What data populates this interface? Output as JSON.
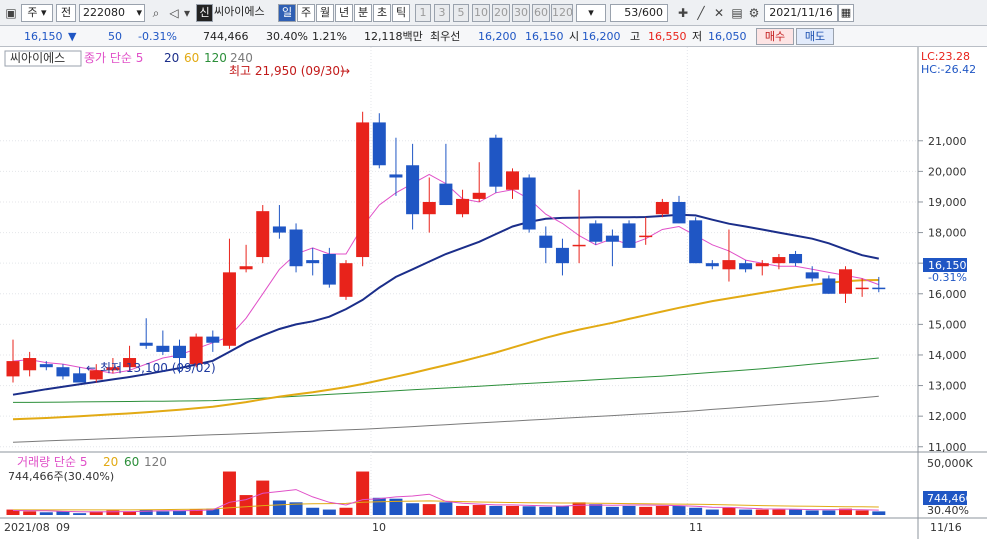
{
  "toolbar": {
    "period_select": "주",
    "prev_label": "전",
    "code": "222080",
    "name": "씨아이에스",
    "new_badge": "신",
    "tabs": [
      "일",
      "주",
      "월",
      "년",
      "분",
      "초",
      "틱"
    ],
    "active_tab": "일",
    "numbers": [
      "1",
      "3",
      "5",
      "10",
      "20",
      "30",
      "60",
      "120"
    ],
    "count": "53/600",
    "date": "2021/11/16"
  },
  "quote": {
    "price": "16,150",
    "change": "50",
    "change_pct": "-0.31%",
    "volume": "744,466",
    "turnover_pct": "30.40%",
    "pct2": "1.21%",
    "amount": "12,118백만",
    "best_bid_label": "최우선",
    "best_ask": "16,200",
    "best_bid": "16,150",
    "open_label": "시",
    "open": "16,200",
    "high_label": "고",
    "high": "16,550",
    "low_label": "저",
    "low": "16,050",
    "buy_label": "매수",
    "sell_label": "매도"
  },
  "legend": {
    "name": "씨아이에스",
    "ma_label": "종가 단순 5",
    "ma_periods": [
      "20",
      "60",
      "120",
      "240"
    ],
    "lc": "LC:23.28",
    "hc": "HC:-26.42"
  },
  "annotations": {
    "high": "최고 21,950 (09/30)",
    "low": "최저 13,100 (09/02)"
  },
  "price_box": {
    "value": "16,150",
    "pct": "-0.31%"
  },
  "volume_legend": {
    "label": "거래량 단순 5",
    "periods": [
      "20",
      "60",
      "120"
    ],
    "value_text": "744,466주(30.40%)",
    "axis_top": "50,000K",
    "current": "744,466",
    "current_pct": "30.40%"
  },
  "x_axis": {
    "labels": [
      "2021/08",
      "09",
      "10",
      "11"
    ],
    "end_label": "11/16"
  },
  "colors": {
    "up": "#e8231b",
    "down": "#1f56c4",
    "ma5": "#e050c8",
    "ma20": "#1b2e8a",
    "ma60": "#e2aa14",
    "ma120": "#2c8f3a",
    "ma240": "#7a7a7a",
    "accent": "#2f5fb3"
  },
  "chart_data": {
    "type": "candlestick",
    "y_ticks": [
      11000,
      12000,
      13000,
      14000,
      15000,
      16000,
      17000,
      18000,
      19000,
      20000,
      21000
    ],
    "ylim": [
      10600,
      22300
    ],
    "candles": [
      {
        "o": 13300,
        "h": 14500,
        "l": 13100,
        "c": 13800
      },
      {
        "o": 13500,
        "h": 14100,
        "l": 13300,
        "c": 13900
      },
      {
        "o": 13700,
        "h": 13800,
        "l": 13500,
        "c": 13600
      },
      {
        "o": 13600,
        "h": 13700,
        "l": 13200,
        "c": 13300
      },
      {
        "o": 13400,
        "h": 13600,
        "l": 13100,
        "c": 13100
      },
      {
        "o": 13200,
        "h": 13700,
        "l": 13100,
        "c": 13500
      },
      {
        "o": 13500,
        "h": 13900,
        "l": 13400,
        "c": 13600
      },
      {
        "o": 13600,
        "h": 14300,
        "l": 13500,
        "c": 13900
      },
      {
        "o": 14400,
        "h": 15200,
        "l": 14200,
        "c": 14300
      },
      {
        "o": 14300,
        "h": 14800,
        "l": 14000,
        "c": 14100
      },
      {
        "o": 14300,
        "h": 14500,
        "l": 13400,
        "c": 13900
      },
      {
        "o": 13700,
        "h": 14700,
        "l": 13600,
        "c": 14600
      },
      {
        "o": 14600,
        "h": 14800,
        "l": 14100,
        "c": 14400
      },
      {
        "o": 14300,
        "h": 17800,
        "l": 14200,
        "c": 16700
      },
      {
        "o": 16800,
        "h": 17600,
        "l": 16700,
        "c": 16900
      },
      {
        "o": 17200,
        "h": 18900,
        "l": 17000,
        "c": 18700
      },
      {
        "o": 18200,
        "h": 18900,
        "l": 17800,
        "c": 18000
      },
      {
        "o": 18100,
        "h": 18300,
        "l": 16700,
        "c": 16900
      },
      {
        "o": 17100,
        "h": 17500,
        "l": 16600,
        "c": 17000
      },
      {
        "o": 17300,
        "h": 17500,
        "l": 16200,
        "c": 16300
      },
      {
        "o": 15900,
        "h": 17100,
        "l": 15800,
        "c": 17000
      },
      {
        "o": 17200,
        "h": 21950,
        "l": 16900,
        "c": 21600
      },
      {
        "o": 21600,
        "h": 21900,
        "l": 20100,
        "c": 20200
      },
      {
        "o": 19900,
        "h": 21100,
        "l": 19200,
        "c": 19800
      },
      {
        "o": 20200,
        "h": 20900,
        "l": 18100,
        "c": 18600
      },
      {
        "o": 18600,
        "h": 19800,
        "l": 18000,
        "c": 19000
      },
      {
        "o": 19600,
        "h": 20900,
        "l": 18900,
        "c": 18900
      },
      {
        "o": 18600,
        "h": 19400,
        "l": 18500,
        "c": 19100
      },
      {
        "o": 19100,
        "h": 20300,
        "l": 19000,
        "c": 19300
      },
      {
        "o": 21100,
        "h": 21200,
        "l": 19300,
        "c": 19500
      },
      {
        "o": 19400,
        "h": 20100,
        "l": 19100,
        "c": 20000
      },
      {
        "o": 19800,
        "h": 19900,
        "l": 18000,
        "c": 18100
      },
      {
        "o": 17900,
        "h": 18200,
        "l": 17000,
        "c": 17500
      },
      {
        "o": 17500,
        "h": 17800,
        "l": 16600,
        "c": 17000
      },
      {
        "o": 17600,
        "h": 19400,
        "l": 17000,
        "c": 17600
      },
      {
        "o": 18300,
        "h": 18400,
        "l": 17600,
        "c": 17700
      },
      {
        "o": 17900,
        "h": 18100,
        "l": 16900,
        "c": 17700
      },
      {
        "o": 18300,
        "h": 18400,
        "l": 17500,
        "c": 17500
      },
      {
        "o": 17900,
        "h": 18500,
        "l": 17600,
        "c": 17900
      },
      {
        "o": 18600,
        "h": 19100,
        "l": 18500,
        "c": 19000
      },
      {
        "o": 19000,
        "h": 19200,
        "l": 18300,
        "c": 18300
      },
      {
        "o": 18400,
        "h": 18500,
        "l": 17000,
        "c": 17000
      },
      {
        "o": 17000,
        "h": 17100,
        "l": 16800,
        "c": 16900
      },
      {
        "o": 16800,
        "h": 18100,
        "l": 16400,
        "c": 17100
      },
      {
        "o": 17000,
        "h": 17100,
        "l": 16700,
        "c": 16800
      },
      {
        "o": 16900,
        "h": 17100,
        "l": 16600,
        "c": 17000
      },
      {
        "o": 17000,
        "h": 17300,
        "l": 16800,
        "c": 17200
      },
      {
        "o": 17300,
        "h": 17400,
        "l": 16900,
        "c": 17000
      },
      {
        "o": 16700,
        "h": 16900,
        "l": 16400,
        "c": 16500
      },
      {
        "o": 16500,
        "h": 16600,
        "l": 16000,
        "c": 16000
      },
      {
        "o": 16000,
        "h": 16900,
        "l": 15700,
        "c": 16800
      },
      {
        "o": 16200,
        "h": 16500,
        "l": 15900,
        "c": 16200
      },
      {
        "o": 16200,
        "h": 16550,
        "l": 16050,
        "c": 16150
      }
    ],
    "ma5": [
      13800,
      13850,
      13750,
      13700,
      13600,
      13500,
      13400,
      13500,
      13700,
      13900,
      14000,
      14200,
      14400,
      14600,
      15200,
      16000,
      16800,
      17300,
      17500,
      17300,
      17300,
      18200,
      18900,
      19300,
      19600,
      19900,
      19600,
      19100,
      19000,
      19300,
      19400,
      19100,
      18600,
      18300,
      17900,
      17600,
      17800,
      17600,
      17800,
      18100,
      18200,
      17900,
      17600,
      17400,
      17100,
      17000,
      16900,
      16900,
      16800,
      16700,
      16600,
      16500,
      16300
    ],
    "ma20": [
      12700,
      12790,
      12880,
      12960,
      13040,
      13120,
      13200,
      13280,
      13370,
      13470,
      13570,
      13690,
      13810,
      14100,
      14400,
      14640,
      14850,
      15000,
      15100,
      15250,
      15500,
      15800,
      16200,
      16550,
      16800,
      17050,
      17300,
      17500,
      17700,
      17950,
      18200,
      18350,
      18450,
      18480,
      18490,
      18500,
      18500,
      18500,
      18510,
      18540,
      18580,
      18560,
      18420,
      18290,
      18200,
      18100,
      18000,
      17900,
      17800,
      17650,
      17450,
      17260,
      17150
    ],
    "ma60": [
      11900,
      11920,
      11940,
      11970,
      12000,
      12030,
      12060,
      12090,
      12130,
      12170,
      12210,
      12260,
      12310,
      12380,
      12460,
      12550,
      12640,
      12710,
      12780,
      12860,
      12950,
      13050,
      13170,
      13290,
      13410,
      13540,
      13670,
      13800,
      13940,
      14080,
      14240,
      14400,
      14560,
      14700,
      14830,
      14940,
      15050,
      15180,
      15300,
      15420,
      15540,
      15650,
      15760,
      15850,
      15940,
      16030,
      16120,
      16210,
      16290,
      16360,
      16410,
      16440,
      16450
    ],
    "ma120": [
      12450,
      12450,
      12455,
      12460,
      12465,
      12470,
      12475,
      12480,
      12485,
      12490,
      12495,
      12500,
      12510,
      12530,
      12560,
      12590,
      12620,
      12650,
      12680,
      12710,
      12740,
      12770,
      12800,
      12830,
      12860,
      12890,
      12920,
      12950,
      12980,
      13010,
      13040,
      13070,
      13100,
      13130,
      13160,
      13190,
      13220,
      13250,
      13280,
      13310,
      13350,
      13390,
      13430,
      13470,
      13510,
      13550,
      13600,
      13650,
      13700,
      13750,
      13800,
      13850,
      13900
    ],
    "ma240": [
      11150,
      11170,
      11190,
      11210,
      11230,
      11250,
      11270,
      11290,
      11310,
      11330,
      11350,
      11370,
      11390,
      11410,
      11430,
      11450,
      11470,
      11490,
      11510,
      11530,
      11550,
      11570,
      11600,
      11630,
      11660,
      11690,
      11720,
      11750,
      11780,
      11810,
      11840,
      11870,
      11900,
      11930,
      11960,
      11990,
      12020,
      12050,
      12080,
      12110,
      12140,
      12180,
      12220,
      12260,
      12300,
      12340,
      12380,
      12420,
      12460,
      12500,
      12550,
      12600,
      12650
    ],
    "volume": [
      300,
      200,
      150,
      200,
      100,
      200,
      250,
      200,
      300,
      200,
      250,
      300,
      350,
      2400,
      1100,
      1900,
      800,
      700,
      400,
      300,
      400,
      2400,
      950,
      900,
      650,
      600,
      700,
      500,
      550,
      500,
      500,
      480,
      450,
      500,
      700,
      600,
      450,
      500,
      450,
      500,
      500,
      400,
      300,
      400,
      300,
      300,
      300,
      300,
      250,
      250,
      350,
      250,
      200
    ],
    "vol_ma5": [
      250,
      240,
      230,
      200,
      180,
      170,
      180,
      190,
      210,
      230,
      240,
      250,
      280,
      700,
      850,
      1200,
      1300,
      1400,
      1000,
      700,
      550,
      850,
      900,
      1000,
      1050,
      1150,
      750,
      650,
      600,
      560,
      560,
      530,
      500,
      490,
      540,
      550,
      540,
      550,
      550,
      540,
      520,
      480,
      430,
      420,
      380,
      340,
      330,
      320,
      300,
      290,
      300,
      290,
      270
    ],
    "vol_ma20": [
      280,
      280,
      280,
      280,
      280,
      280,
      280,
      280,
      290,
      300,
      310,
      320,
      330,
      400,
      450,
      520,
      560,
      600,
      620,
      630,
      640,
      700,
      730,
      750,
      770,
      780,
      760,
      740,
      720,
      700,
      690,
      680,
      670,
      660,
      660,
      650,
      640,
      630,
      620,
      610,
      600,
      590,
      580,
      560,
      540,
      520,
      500,
      490,
      480,
      470,
      460,
      450,
      440
    ],
    "vol_ylim": [
      0,
      2650
    ]
  }
}
